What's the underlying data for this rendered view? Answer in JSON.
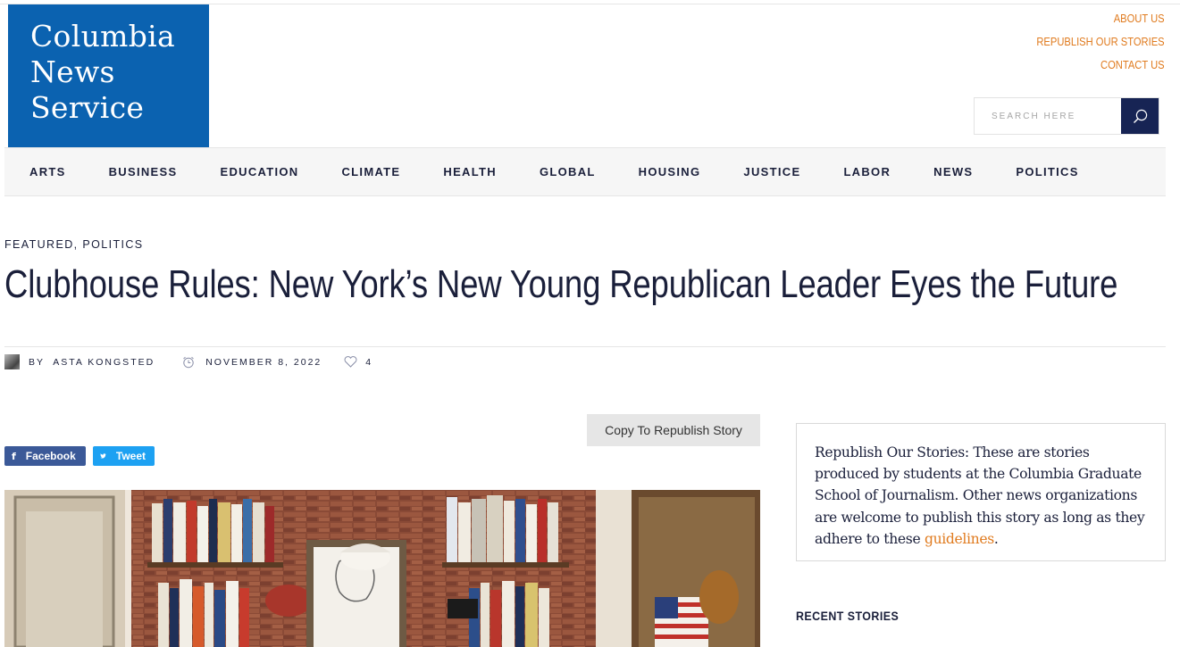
{
  "logo": {
    "line1": "Columbia",
    "line2": "News",
    "line3": "Service"
  },
  "util_links": [
    "ABOUT US",
    "REPUBLISH OUR STORIES",
    "CONTACT US"
  ],
  "search": {
    "placeholder": "SEARCH HERE"
  },
  "nav": [
    "ARTS",
    "BUSINESS",
    "EDUCATION",
    "CLIMATE",
    "HEALTH",
    "GLOBAL",
    "HOUSING",
    "JUSTICE",
    "LABOR",
    "NEWS",
    "POLITICS"
  ],
  "article": {
    "categories": [
      "FEATURED",
      "POLITICS"
    ],
    "category_sep": ",",
    "title": "Clubhouse Rules: New York’s New Young Republican Leader Eyes the Future",
    "byline_prefix": "BY",
    "author": "ASTA KONGSTED",
    "date": "NOVEMBER 8, 2022",
    "likes": "4"
  },
  "copy_button": "Copy To Republish Story",
  "share": {
    "facebook": "Facebook",
    "tweet": "Tweet"
  },
  "sidebar": {
    "republish_text": "Republish Our Stories: These are stories produced by students at the Columbia Graduate School of Journalism. Other news organizations are welcome to publish this story as long as they adhere to these ",
    "republish_link": "guidelines",
    "republish_end": ".",
    "recent_heading": "RECENT STORIES"
  },
  "colors": {
    "brand_blue": "#0b62b0",
    "accent_orange": "#e07b1f",
    "navy": "#172454"
  },
  "icons": [
    "search-icon",
    "clock-icon",
    "heart-icon",
    "facebook-icon",
    "twitter-icon"
  ]
}
